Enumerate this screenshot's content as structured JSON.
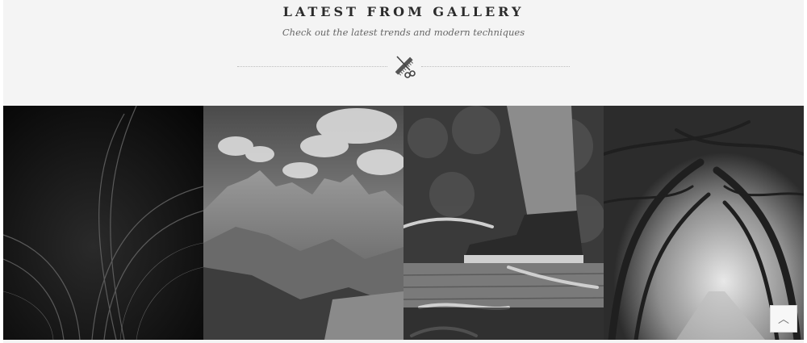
{
  "section": {
    "title": "LATEST FROM GALLERY",
    "subtitle": "Check out the latest trends and modern techniques",
    "divider_icon": "barber-comb-scissors-icon"
  },
  "gallery": {
    "items": [
      {
        "name": "gallery-item-book-pages",
        "description_icon": "image-book-pages"
      },
      {
        "name": "gallery-item-mountains",
        "description_icon": "image-mountains"
      },
      {
        "name": "gallery-item-boot-on-log",
        "description_icon": "image-boot-log"
      },
      {
        "name": "gallery-item-tree-tunnel",
        "description_icon": "image-tree-tunnel"
      }
    ]
  },
  "scroll_to_top": {
    "icon": "chevron-up-icon",
    "glyph": "︿"
  },
  "colors": {
    "background": "#f4f4f4",
    "title": "#2b2b2b",
    "subtitle": "#666666"
  }
}
